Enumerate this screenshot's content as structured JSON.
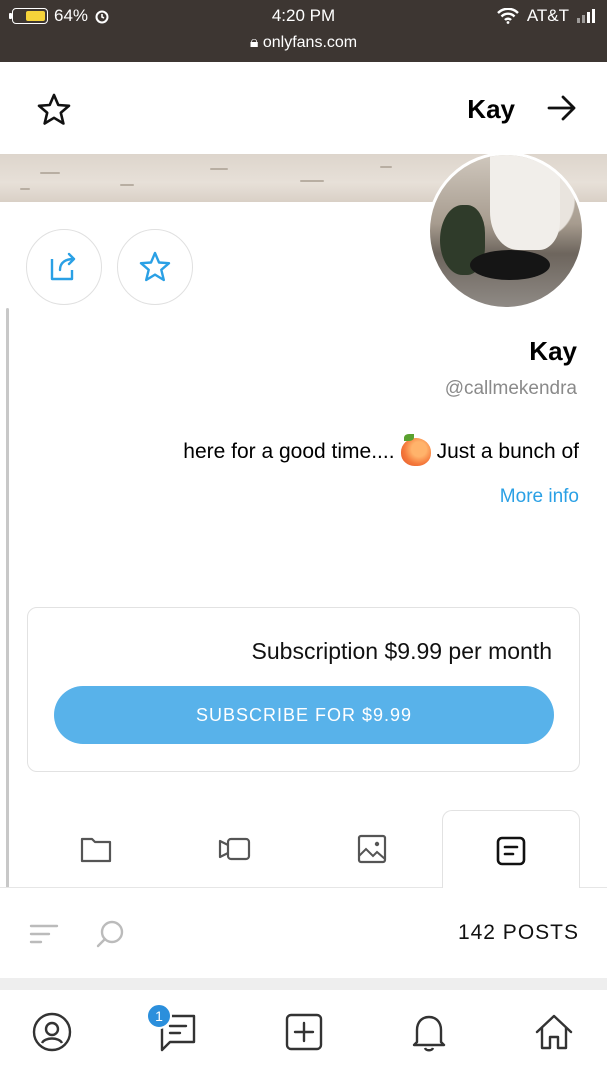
{
  "status_bar": {
    "battery": "64%",
    "battery_level": 0.64,
    "time": "4:20 PM",
    "carrier": "AT&T",
    "url": "onlyfans.com"
  },
  "header": {
    "title": "Kay"
  },
  "profile": {
    "name": "Kay",
    "handle": "@callmekendra",
    "bio_before": "Just a bunch of",
    "bio_after": "here for a good time....",
    "more_info": "More info"
  },
  "subscription": {
    "text": "Subscription $9.99 per month",
    "button": "SUBSCRIBE FOR $9.99"
  },
  "posts": {
    "label": "142 POSTS"
  },
  "bottom_nav": {
    "messages_badge": "1"
  },
  "icons": {
    "accent": "#2aa0e5",
    "button": "#58b2ea"
  }
}
